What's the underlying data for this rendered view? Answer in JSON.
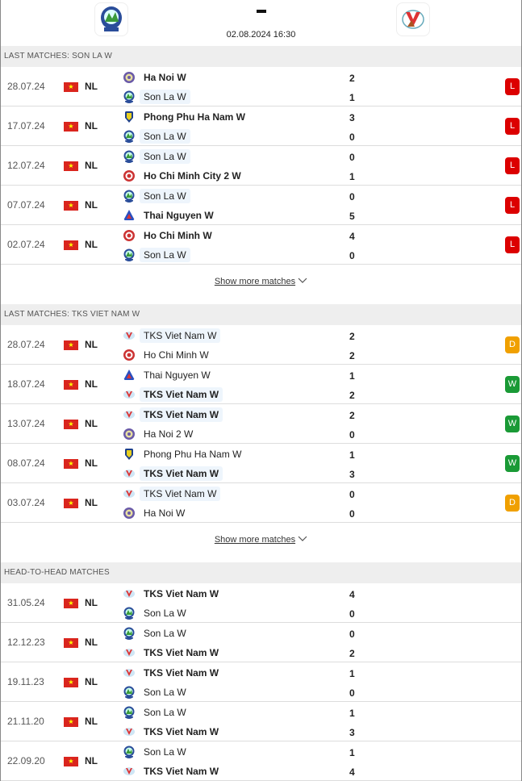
{
  "header": {
    "score": "-",
    "datetime": "02.08.2024 16:30",
    "home_logo": "son-la-w-logo",
    "away_logo": "tks-viet-nam-w-logo"
  },
  "colors": {
    "L": "#dc0000",
    "W": "#1a9a36",
    "D": "#f0a000",
    "highlight": "#eef5fc"
  },
  "sections": [
    {
      "title": "LAST MATCHES: SON LA W",
      "more": "Show more matches",
      "matches": [
        {
          "date": "28.07.24",
          "league": "NL",
          "home": "Ha Noi W",
          "away": "Son La W",
          "hs": "2",
          "as": "1",
          "result": "L",
          "hl": "away",
          "win": "home",
          "hi": "hanoi",
          "ai": "sonla"
        },
        {
          "date": "17.07.24",
          "league": "NL",
          "home": "Phong Phu Ha Nam W",
          "away": "Son La W",
          "hs": "3",
          "as": "0",
          "result": "L",
          "hl": "away",
          "win": "home",
          "hi": "phongphu",
          "ai": "sonla"
        },
        {
          "date": "12.07.24",
          "league": "NL",
          "home": "Son La W",
          "away": "Ho Chi Minh City 2 W",
          "hs": "0",
          "as": "1",
          "result": "L",
          "hl": "home",
          "win": "away",
          "hi": "sonla",
          "ai": "hcm"
        },
        {
          "date": "07.07.24",
          "league": "NL",
          "home": "Son La W",
          "away": "Thai Nguyen W",
          "hs": "0",
          "as": "5",
          "result": "L",
          "hl": "home",
          "win": "away",
          "hi": "sonla",
          "ai": "thainguyen"
        },
        {
          "date": "02.07.24",
          "league": "NL",
          "home": "Ho Chi Minh W",
          "away": "Son La W",
          "hs": "4",
          "as": "0",
          "result": "L",
          "hl": "away",
          "win": "home",
          "hi": "hcm",
          "ai": "sonla"
        }
      ]
    },
    {
      "title": "LAST MATCHES: TKS VIET NAM W",
      "more": "Show more matches",
      "matches": [
        {
          "date": "28.07.24",
          "league": "NL",
          "home": "TKS Viet Nam W",
          "away": "Ho Chi Minh W",
          "hs": "2",
          "as": "2",
          "result": "D",
          "hl": "home",
          "win": "",
          "hi": "tks",
          "ai": "hcm"
        },
        {
          "date": "18.07.24",
          "league": "NL",
          "home": "Thai Nguyen W",
          "away": "TKS Viet Nam W",
          "hs": "1",
          "as": "2",
          "result": "W",
          "hl": "away",
          "win": "away",
          "hi": "thainguyen",
          "ai": "tks"
        },
        {
          "date": "13.07.24",
          "league": "NL",
          "home": "TKS Viet Nam W",
          "away": "Ha Noi 2 W",
          "hs": "2",
          "as": "0",
          "result": "W",
          "hl": "home",
          "win": "home",
          "hi": "tks",
          "ai": "hanoi"
        },
        {
          "date": "08.07.24",
          "league": "NL",
          "home": "Phong Phu Ha Nam W",
          "away": "TKS Viet Nam W",
          "hs": "1",
          "as": "3",
          "result": "W",
          "hl": "away",
          "win": "away",
          "hi": "phongphu",
          "ai": "tks"
        },
        {
          "date": "03.07.24",
          "league": "NL",
          "home": "TKS Viet Nam W",
          "away": "Ha Noi W",
          "hs": "0",
          "as": "0",
          "result": "D",
          "hl": "home",
          "win": "",
          "hi": "tks",
          "ai": "hanoi"
        }
      ]
    },
    {
      "title": "HEAD-TO-HEAD MATCHES",
      "more": "",
      "matches": [
        {
          "date": "31.05.24",
          "league": "NL",
          "home": "TKS Viet Nam W",
          "away": "Son La W",
          "hs": "4",
          "as": "0",
          "result": "",
          "hl": "",
          "win": "home",
          "hi": "tks",
          "ai": "sonla"
        },
        {
          "date": "12.12.23",
          "league": "NL",
          "home": "Son La W",
          "away": "TKS Viet Nam W",
          "hs": "0",
          "as": "2",
          "result": "",
          "hl": "",
          "win": "away",
          "hi": "sonla",
          "ai": "tks"
        },
        {
          "date": "19.11.23",
          "league": "NL",
          "home": "TKS Viet Nam W",
          "away": "Son La W",
          "hs": "1",
          "as": "0",
          "result": "",
          "hl": "",
          "win": "home",
          "hi": "tks",
          "ai": "sonla"
        },
        {
          "date": "21.11.20",
          "league": "NL",
          "home": "Son La W",
          "away": "TKS Viet Nam W",
          "hs": "1",
          "as": "3",
          "result": "",
          "hl": "",
          "win": "away",
          "hi": "sonla",
          "ai": "tks"
        },
        {
          "date": "22.09.20",
          "league": "NL",
          "home": "Son La W",
          "away": "TKS Viet Nam W",
          "hs": "1",
          "as": "4",
          "result": "",
          "hl": "",
          "win": "away",
          "hi": "sonla",
          "ai": "tks"
        }
      ]
    }
  ]
}
